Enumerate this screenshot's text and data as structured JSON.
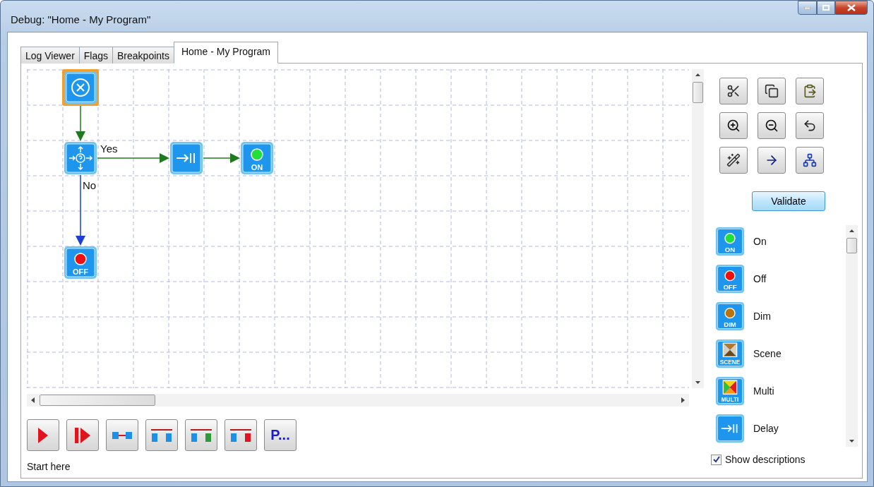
{
  "window": {
    "title": "Debug: \"Home - My Program\""
  },
  "tabs": [
    {
      "label": "Log Viewer",
      "selected": false
    },
    {
      "label": "Flags",
      "selected": false
    },
    {
      "label": "Breakpoints",
      "selected": false
    },
    {
      "label": "Home - My Program",
      "selected": true
    }
  ],
  "diagram": {
    "nodes": [
      {
        "kind": "start",
        "selected": true
      },
      {
        "kind": "decision",
        "selected": false
      },
      {
        "kind": "delay",
        "selected": false
      },
      {
        "kind": "on",
        "badge": "ON",
        "selected": false
      },
      {
        "kind": "off",
        "badge": "OFF",
        "selected": false
      }
    ],
    "edges": [
      {
        "kind": "flow"
      },
      {
        "kind": "yes",
        "label": "Yes"
      },
      {
        "kind": "flow"
      },
      {
        "kind": "no",
        "label": "No"
      }
    ]
  },
  "run_buttons": [
    {
      "kind": "run"
    },
    {
      "kind": "step"
    },
    {
      "kind": "link"
    },
    {
      "kind": "split"
    },
    {
      "kind": "split-green"
    },
    {
      "kind": "split-red"
    },
    {
      "kind": "text",
      "label": "P..."
    }
  ],
  "status": "Start here",
  "validate_button": "Validate",
  "palette": [
    {
      "kind": "on",
      "badge": "ON",
      "label": "On"
    },
    {
      "kind": "off",
      "badge": "OFF",
      "label": "Off"
    },
    {
      "kind": "dim",
      "badge": "DIM",
      "label": "Dim"
    },
    {
      "kind": "scene",
      "badge": "SCENE",
      "label": "Scene"
    },
    {
      "kind": "multi",
      "badge": "MULTI",
      "label": "Multi"
    },
    {
      "kind": "delay",
      "label": "Delay"
    }
  ],
  "show_descriptions": {
    "label": "Show descriptions",
    "checked": true
  }
}
